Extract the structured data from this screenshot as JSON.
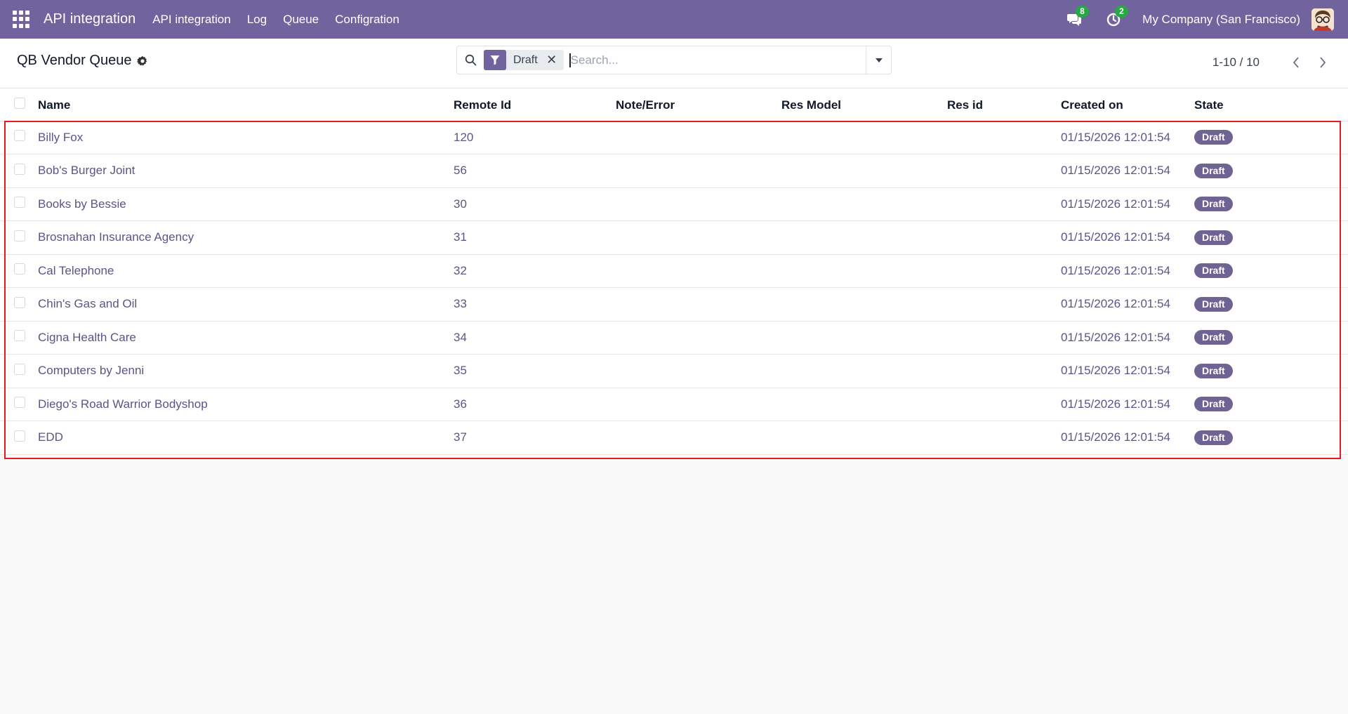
{
  "navbar": {
    "brand": "API integration",
    "menu": [
      "API integration",
      "Log",
      "Queue",
      "Configration"
    ],
    "messages_count": "8",
    "activities_count": "2",
    "company": "My Company (San Francisco)",
    "colors": {
      "navbar_bg": "#71639e",
      "badge_green": "#28a745"
    }
  },
  "control_panel": {
    "title": "QB Vendor Queue",
    "search": {
      "facet_value": "Draft",
      "placeholder": "Search..."
    },
    "pager": "1-10 / 10"
  },
  "table": {
    "columns": [
      "Name",
      "Remote Id",
      "Note/Error",
      "Res Model",
      "Res id",
      "Created on",
      "State"
    ],
    "rows": [
      {
        "name": "Billy Fox",
        "remote_id": "120",
        "note": "",
        "res_model": "",
        "res_id": "",
        "created_on": "01/15/2026 12:01:54",
        "state": "Draft"
      },
      {
        "name": "Bob's Burger Joint",
        "remote_id": "56",
        "note": "",
        "res_model": "",
        "res_id": "",
        "created_on": "01/15/2026 12:01:54",
        "state": "Draft"
      },
      {
        "name": "Books by Bessie",
        "remote_id": "30",
        "note": "",
        "res_model": "",
        "res_id": "",
        "created_on": "01/15/2026 12:01:54",
        "state": "Draft"
      },
      {
        "name": "Brosnahan Insurance Agency",
        "remote_id": "31",
        "note": "",
        "res_model": "",
        "res_id": "",
        "created_on": "01/15/2026 12:01:54",
        "state": "Draft"
      },
      {
        "name": "Cal Telephone",
        "remote_id": "32",
        "note": "",
        "res_model": "",
        "res_id": "",
        "created_on": "01/15/2026 12:01:54",
        "state": "Draft"
      },
      {
        "name": "Chin's Gas and Oil",
        "remote_id": "33",
        "note": "",
        "res_model": "",
        "res_id": "",
        "created_on": "01/15/2026 12:01:54",
        "state": "Draft"
      },
      {
        "name": "Cigna Health Care",
        "remote_id": "34",
        "note": "",
        "res_model": "",
        "res_id": "",
        "created_on": "01/15/2026 12:01:54",
        "state": "Draft"
      },
      {
        "name": "Computers by Jenni",
        "remote_id": "35",
        "note": "",
        "res_model": "",
        "res_id": "",
        "created_on": "01/15/2026 12:01:54",
        "state": "Draft"
      },
      {
        "name": "Diego's Road Warrior Bodyshop",
        "remote_id": "36",
        "note": "",
        "res_model": "",
        "res_id": "",
        "created_on": "01/15/2026 12:01:54",
        "state": "Draft"
      },
      {
        "name": "EDD",
        "remote_id": "37",
        "note": "",
        "res_model": "",
        "res_id": "",
        "created_on": "01/15/2026 12:01:54",
        "state": "Draft"
      }
    ],
    "highlight_color": "#e8191f"
  }
}
